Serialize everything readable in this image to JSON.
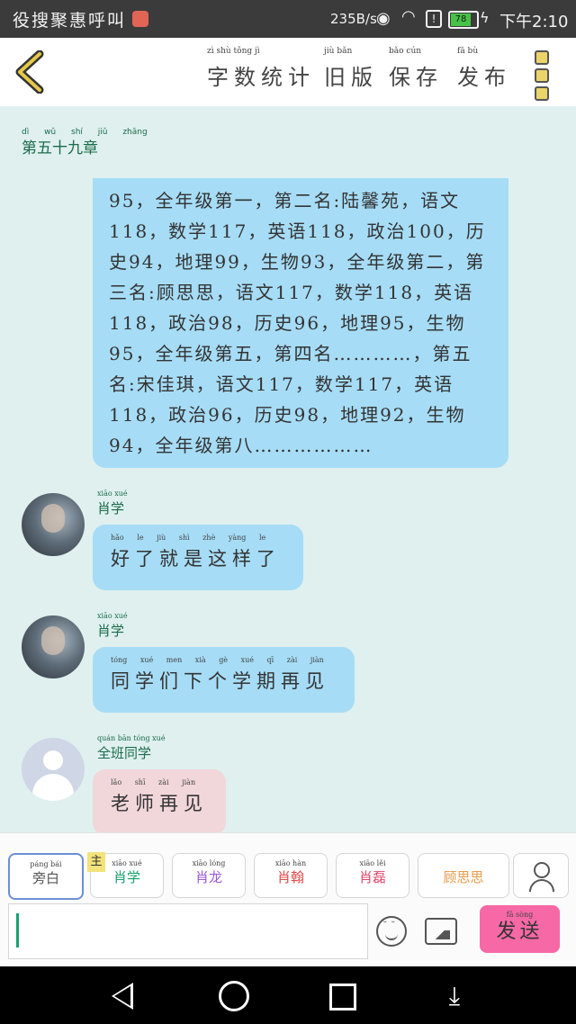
{
  "status_bar": {
    "left_text": "役搜聚惠呼叫",
    "net_speed": "235B/s",
    "battery_level": "78",
    "battery_fraction": 0.78,
    "time": "下午2:10"
  },
  "top_bar": {
    "actions": [
      {
        "label": "字数统计",
        "pinyin": "zì shù tǒng jì"
      },
      {
        "label": "旧版",
        "pinyin": "jiù bǎn"
      },
      {
        "label": "保存",
        "pinyin": "bǎo cún"
      },
      {
        "label": "发布",
        "pinyin": "fā bù"
      }
    ]
  },
  "chapter": {
    "title": "第五十九章",
    "pinyin": "dì wǔ shí jiǔ zhāng"
  },
  "messages": [
    {
      "type": "narration",
      "text": "95，全年级第一，第二名:陆馨苑，语文118，数学117，英语118，政治100，历史94，地理99，生物93，全年级第二，第三名:顾思思，语文117，数学118，英语118，政治98，历史96，地理95，生物95，全年级第五，第四名…………，第五名:宋佳琪，语文117，数学117，英语118，政治96，历史98，地理92，生物94，全年级第八………………"
    },
    {
      "sender": "肖学",
      "sender_pinyin": "xiāo xué",
      "text": "好了就是这样了",
      "pinyin": "hǎo le jiù shì zhè yàng le"
    },
    {
      "sender": "肖学",
      "sender_pinyin": "xiāo xué",
      "text": "同学们下个学期再见",
      "pinyin": "tóng xué men xià gè xué qī zài jiàn"
    },
    {
      "sender": "全班同学",
      "sender_pinyin": "quán bān tóng xué",
      "text": "老师再见",
      "pinyin": "lǎo shī zài jiàn"
    }
  ],
  "roles": [
    {
      "label": "旁白",
      "pinyin": "páng bái",
      "color": "#555555"
    },
    {
      "label": "肖学",
      "pinyin": "xiāo xué",
      "color": "#1aa06d",
      "tag": "主"
    },
    {
      "label": "肖龙",
      "pinyin": "xiāo lóng",
      "color": "#9b59d6"
    },
    {
      "label": "肖翰",
      "pinyin": "xiāo hàn",
      "color": "#e04848"
    },
    {
      "label": "肖磊",
      "pinyin": "xiāo lěi",
      "color": "#e0486a"
    },
    {
      "label": "顾思思",
      "pinyin": "",
      "color": "#e89a4a"
    }
  ],
  "input": {
    "value": ""
  },
  "send_button": {
    "label": "发送",
    "pinyin": "fā sòng"
  },
  "colors": {
    "accent": "#f768a6",
    "bubble": "#a6dcf6",
    "background": "#dff0ef"
  }
}
